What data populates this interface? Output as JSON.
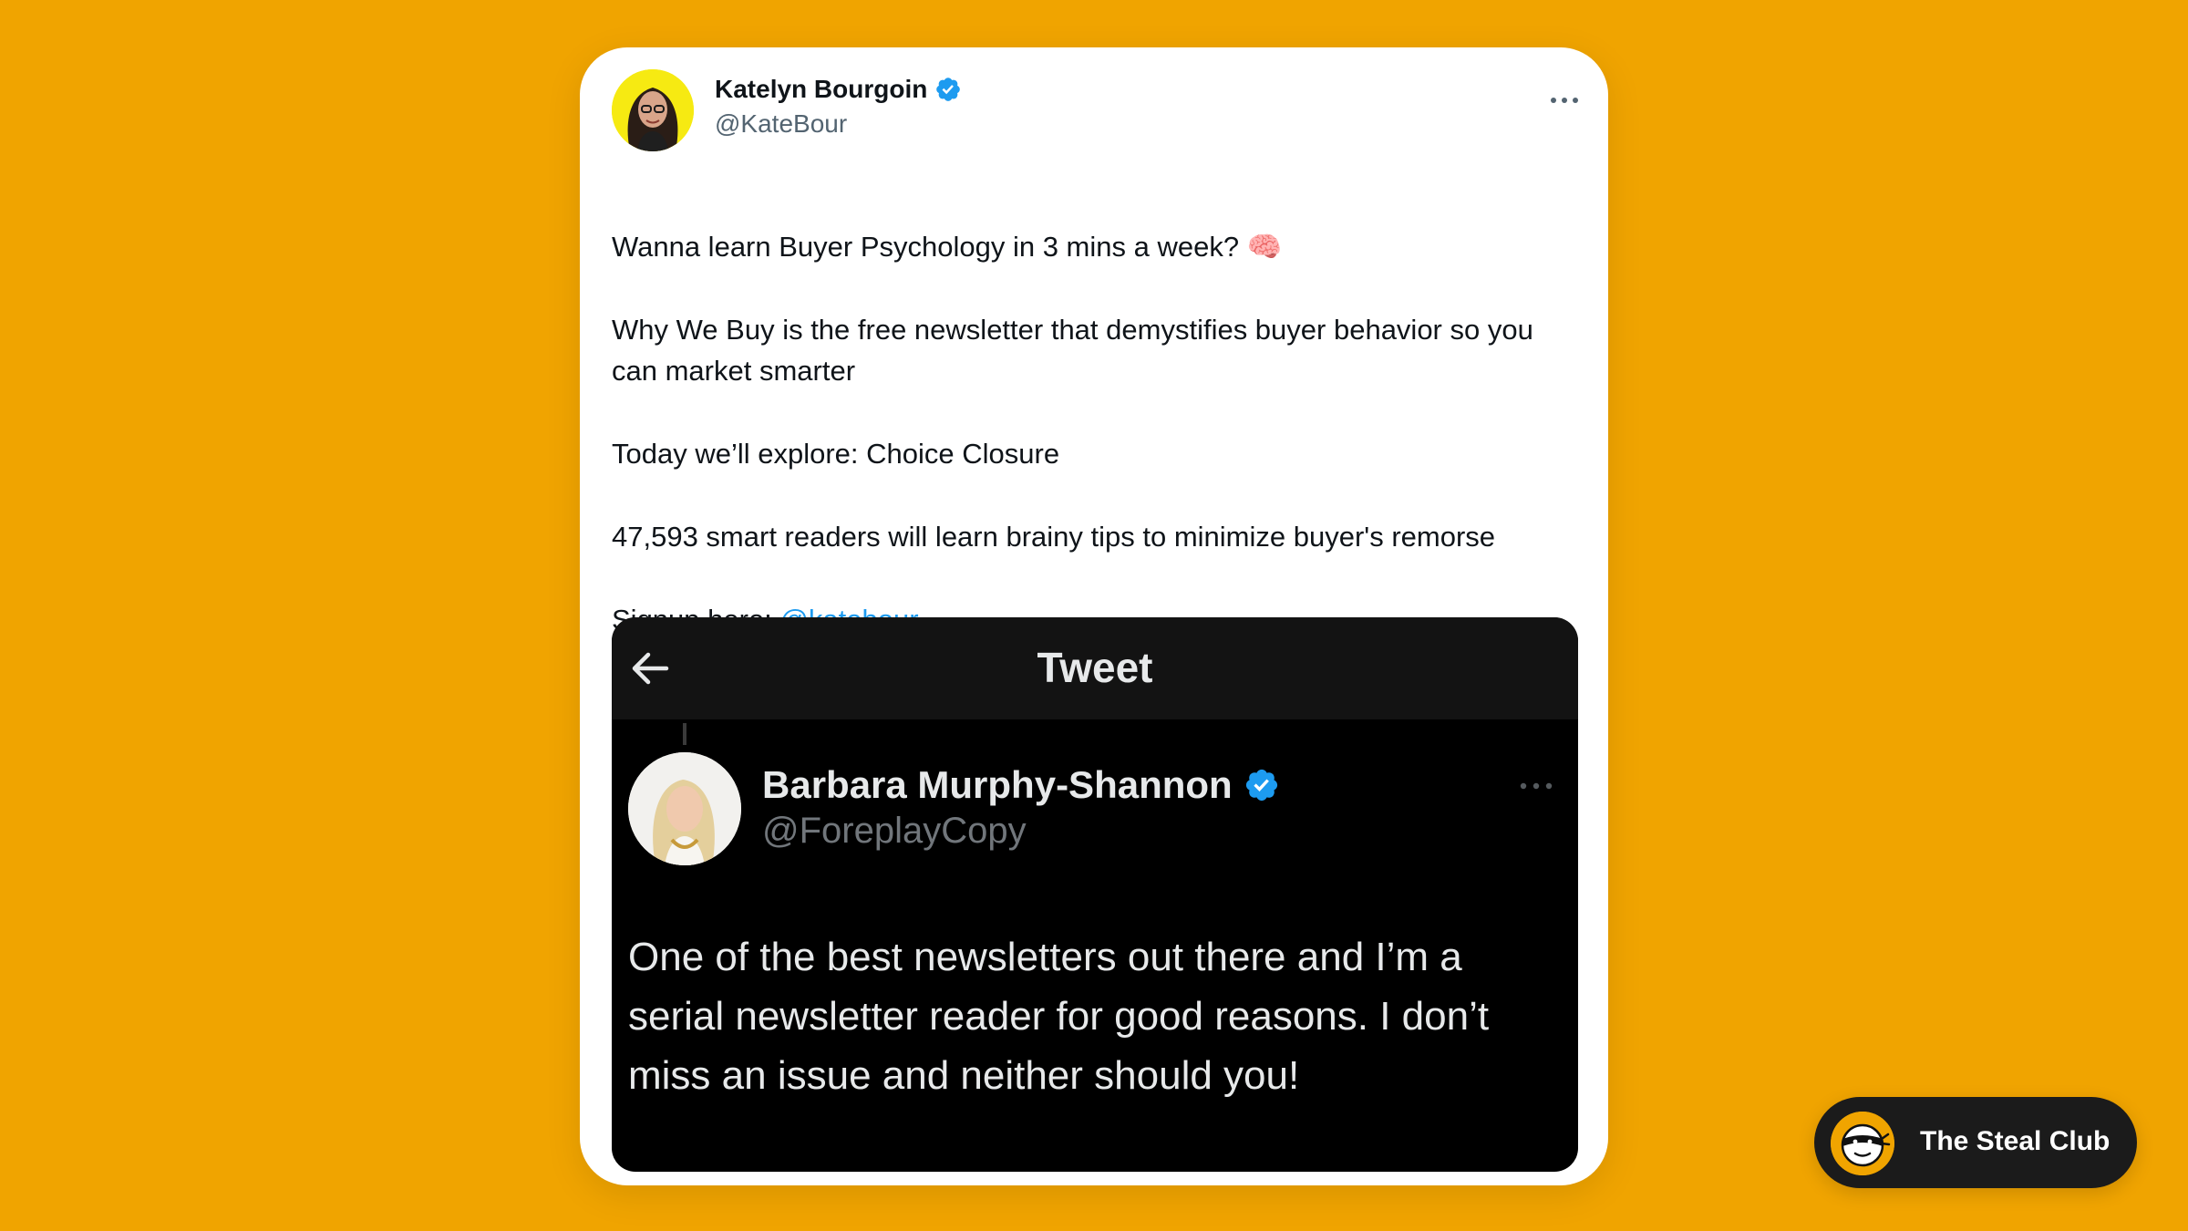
{
  "tweet": {
    "author": {
      "name": "Katelyn Bourgoin",
      "handle": "@KateBour",
      "verified": true
    },
    "more_icon": "more-horizontal-icon",
    "paragraphs": {
      "p1": "Wanna learn Buyer Psychology in 3 mins a week? 🧠",
      "p2": "Why We Buy is the free newsletter that demystifies buyer behavior so you can market smarter",
      "p3": "Today we’ll explore: Choice Closure",
      "p4": "47,593 smart readers will learn brainy tips to minimize buyer's remorse",
      "p5_prefix": "Signup here: ",
      "p5_mention": "@katebour"
    }
  },
  "embedded": {
    "header_title": "Tweet",
    "back_icon": "arrow-left-icon",
    "author": {
      "name": "Barbara Murphy-Shannon",
      "handle": "@ForeplayCopy",
      "verified": true
    },
    "text": "One of the best newsletters out there and I’m a serial newsletter reader for good reasons. I don’t miss an issue and neither should you!"
  },
  "brand": {
    "label": "The Steal Club"
  },
  "colors": {
    "background": "#F0A400",
    "link": "#1D9BF0",
    "verified": "#1D9BF0",
    "card": "#FFFFFF",
    "embed_bg": "#000000",
    "brand_pill": "#1B1B1B"
  }
}
